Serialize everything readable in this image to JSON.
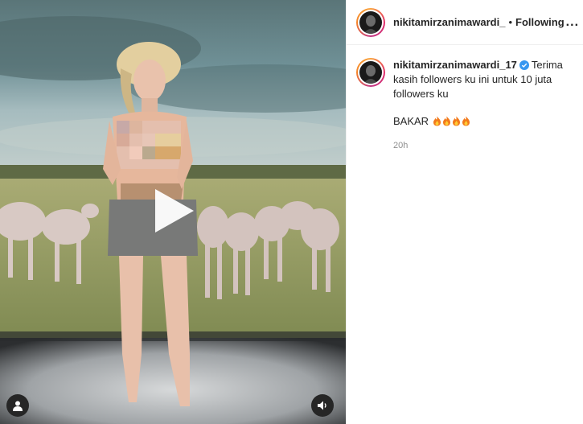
{
  "post": {
    "header": {
      "username": "nikitamirzanimawardi_",
      "separator": "•",
      "follow_state": "Following",
      "more_label": "..."
    },
    "caption": {
      "username": "nikitamirzanimawardi_17",
      "text": "Terima kasih followers ku ini untuk 10 juta followers ku",
      "line2": "BAKAR",
      "emoji": "fire-emoji x4",
      "timestamp": "20h"
    },
    "media": {
      "type": "video",
      "controls": [
        "play-icon",
        "user-tag-icon",
        "sound-icon"
      ]
    },
    "colors": {
      "verified": "#3897f0",
      "ring_start": "#f9a23c",
      "ring_end": "#c13584",
      "muted_text": "#8e8e8e"
    }
  }
}
